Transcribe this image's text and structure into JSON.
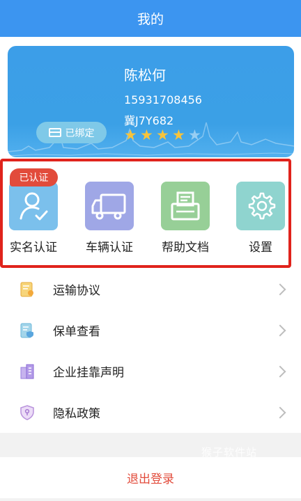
{
  "header": {
    "title": "我的"
  },
  "profile": {
    "name": "陈松何",
    "phone": "15931708456",
    "plate": "冀J7Y682",
    "bound_label": "已绑定",
    "rating": 4,
    "rating_max": 5
  },
  "quick_actions": {
    "verified_badge": "已认证",
    "items": [
      {
        "label": "实名认证",
        "icon": "user-check-icon"
      },
      {
        "label": "车辆认证",
        "icon": "truck-icon"
      },
      {
        "label": "帮助文档",
        "icon": "document-icon"
      },
      {
        "label": "设置",
        "icon": "gear-icon"
      }
    ]
  },
  "menu": {
    "items": [
      {
        "label": "运输协议",
        "icon": "contract-icon"
      },
      {
        "label": "保单查看",
        "icon": "insurance-icon"
      },
      {
        "label": "企业挂靠声明",
        "icon": "building-icon"
      },
      {
        "label": "隐私政策",
        "icon": "shield-icon"
      }
    ]
  },
  "watermark": "猴子软件站",
  "logout": {
    "label": "退出登录"
  },
  "colors": {
    "header": "#3c95f0",
    "card": "#3ba0e6",
    "highlight": "#e0231c",
    "logout_text": "#e24b3b",
    "star": "#f7c43b"
  }
}
